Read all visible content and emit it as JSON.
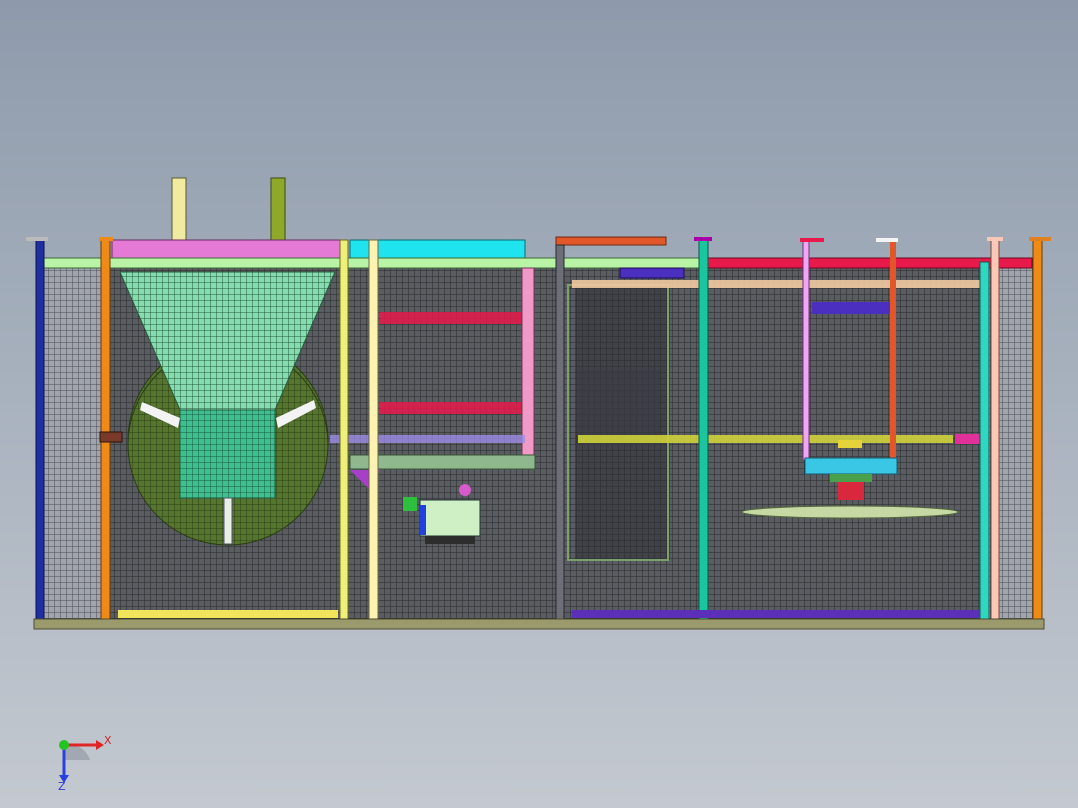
{
  "viewport": {
    "background": "gradient",
    "colors": {
      "grid_fill": "#4a4d52",
      "left_chamber": "#8d9099",
      "hopper": "#7ed8a8",
      "hopper_sphere": "#4f6d2c",
      "magenta_lid": "#e47ad6",
      "cyan_lid": "#1fe3ef",
      "red_beam": "#e8194b",
      "orange_post": "#f08a16",
      "blue_post": "#1f2fa0",
      "base_rail": "#9a9a6c"
    }
  },
  "triad": {
    "x_label": "X",
    "z_label": "Z",
    "x_color": "#e02525",
    "y_color": "#22c322",
    "z_color": "#2a3fe0"
  }
}
